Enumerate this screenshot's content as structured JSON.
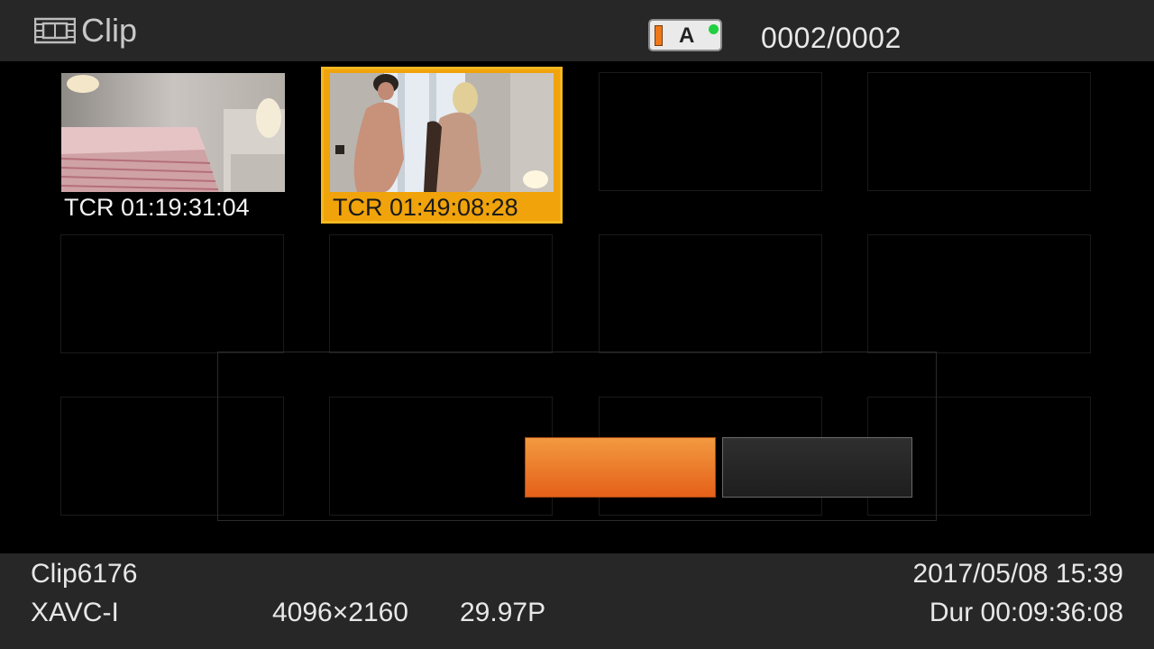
{
  "header": {
    "title": "Clip",
    "title_icon": "film-strip-icon",
    "media_slot": "A",
    "media_slot_color": "#f07818",
    "media_status_color": "#20d040",
    "clip_counter": "0002/0002"
  },
  "clips": [
    {
      "timecode": "TCR 01:19:31:04",
      "selected": false
    },
    {
      "timecode": "TCR 01:49:08:28",
      "selected": true
    }
  ],
  "dialog": {
    "confirm_label": "",
    "cancel_label": "",
    "confirm_color": "#e86a20",
    "cancel_color": "#262626"
  },
  "footer": {
    "clip_name": "Clip6176",
    "codec": "XAVC-I",
    "resolution": "4096×2160",
    "frame_rate": "29.97P",
    "datetime": "2017/05/08 15:39",
    "duration": "Dur 00:09:36:08"
  },
  "colors": {
    "selection": "#f0a30a",
    "bar_background": "#272727"
  }
}
